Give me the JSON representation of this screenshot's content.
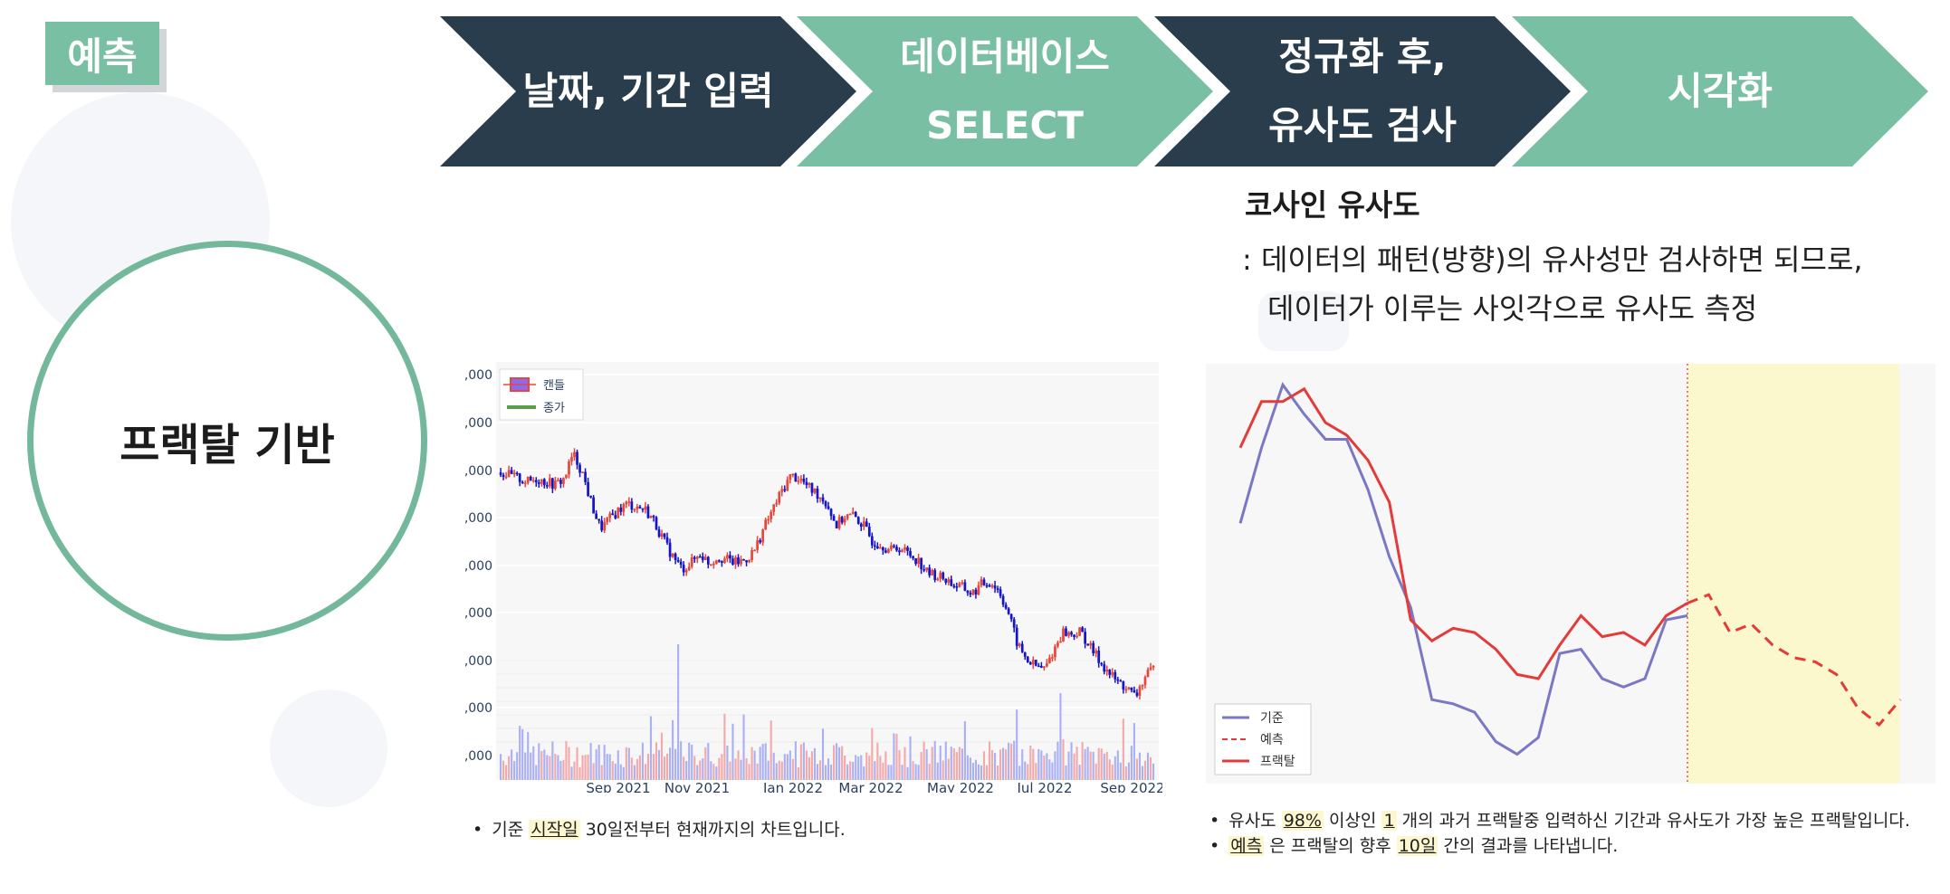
{
  "tag": "예측",
  "center_label": "프랙탈 기반",
  "steps": [
    {
      "label": "날짜, 기간 입력",
      "style": "dark"
    },
    {
      "label": "데이터베이스\nSELECT",
      "style": "green"
    },
    {
      "label": "정규화 후,\n유사도 검사",
      "style": "dark"
    },
    {
      "label": "시각화",
      "style": "green"
    }
  ],
  "cosine": {
    "title": "코사인 유사도",
    "line1": ": 데이터의 패턴(방향)의 유사성만 검사하면 되므로,",
    "line2": "데이터가 이루는 사잇각으로 유사도 측정"
  },
  "colors": {
    "dark": "#2a3d4c",
    "green": "#79bfa3",
    "candle_up": "#e8463b",
    "candle_down": "#1515c8",
    "close_line": "#5a9e4a",
    "base_line": "#7a78c4",
    "fractal_line": "#e33a3a",
    "forecast_band": "#fbf8cd"
  },
  "chart_data": [
    {
      "type": "candlestick",
      "ytick_labels": [
        ",000",
        ",000",
        ",000",
        ",000",
        ",000",
        ",000",
        ",000",
        ",000",
        ",000"
      ],
      "x_tick_labels": [
        "Sep 2021",
        "Nov 2021",
        "Jan 2022",
        "Mar 2022",
        "May 2022",
        "Jul 2022",
        "Sep 2022"
      ],
      "legend": [
        "캔들",
        "종가"
      ],
      "legend_position": "top-left",
      "grid": true,
      "close_relative_levels": [
        0.82,
        0.81,
        0.8,
        0.79,
        0.8,
        0.79,
        0.78,
        0.8,
        0.88,
        0.82,
        0.72,
        0.64,
        0.67,
        0.7,
        0.72,
        0.71,
        0.7,
        0.66,
        0.6,
        0.55,
        0.51,
        0.53,
        0.56,
        0.53,
        0.55,
        0.54,
        0.53,
        0.54,
        0.57,
        0.64,
        0.7,
        0.76,
        0.81,
        0.8,
        0.77,
        0.75,
        0.72,
        0.65,
        0.68,
        0.68,
        0.65,
        0.6,
        0.59,
        0.57,
        0.58,
        0.56,
        0.54,
        0.5,
        0.49,
        0.48,
        0.46,
        0.45,
        0.43,
        0.46,
        0.47,
        0.44,
        0.37,
        0.27,
        0.22,
        0.2,
        0.19,
        0.25,
        0.31,
        0.3,
        0.31,
        0.26,
        0.22,
        0.18,
        0.15,
        0.13,
        0.1,
        0.16,
        0.19
      ],
      "volume_color": [
        "#f2a9a9",
        "#aab0f2"
      ]
    },
    {
      "type": "line",
      "series": [
        {
          "name": "기준",
          "values": [
            0.62,
            0.8,
            0.95,
            0.88,
            0.82,
            0.82,
            0.7,
            0.54,
            0.42,
            0.2,
            0.19,
            0.17,
            0.1,
            0.07,
            0.11,
            0.31,
            0.32,
            0.25,
            0.23,
            0.25,
            0.39,
            0.4
          ]
        },
        {
          "name": "프랙탈",
          "values": [
            0.8,
            0.91,
            0.91,
            0.94,
            0.86,
            0.83,
            0.77,
            0.67,
            0.39,
            0.34,
            0.37,
            0.36,
            0.32,
            0.26,
            0.25,
            0.33,
            0.4,
            0.35,
            0.36,
            0.33,
            0.4,
            0.43
          ]
        },
        {
          "name": "예측",
          "values": [
            0.43,
            0.45,
            0.36,
            0.38,
            0.33,
            0.3,
            0.29,
            0.26,
            0.18,
            0.14,
            0.2
          ]
        }
      ],
      "legend": [
        "기준",
        "예측",
        "프랙탈"
      ],
      "legend_position": "bottom-left",
      "grid": false,
      "forecast_band": true
    }
  ],
  "notes_left": {
    "bullet": "•",
    "pre": "기준 ",
    "hl1": "시작일",
    "post": " 30일전부터 현재까지의 차트입니다."
  },
  "notes_right": [
    {
      "bullet": "•",
      "pre": "유사도 ",
      "hl1": "98%",
      "mid1": " 이상인 ",
      "hl2": "1",
      "post": " 개의 과거 프랙탈중 입력하신 기간과 유사도가 가장 높은 프랙탈입니다."
    },
    {
      "bullet": "•",
      "pre": "",
      "hl1": "예측",
      "mid1": " 은 프랙탈의 향후 ",
      "hl2": "10일",
      "post": " 간의 결과를 나타냅니다."
    }
  ]
}
